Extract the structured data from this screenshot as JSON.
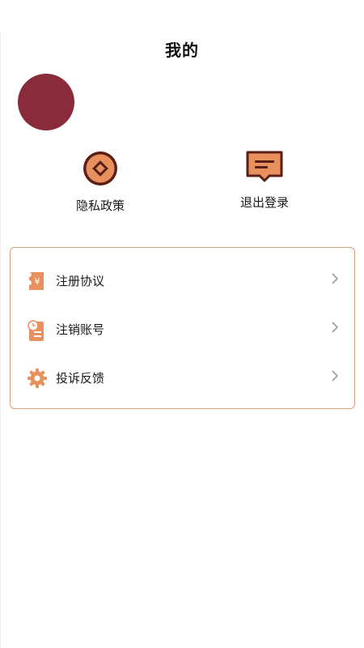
{
  "header": {
    "title": "我的"
  },
  "quick_actions": {
    "privacy_label": "隐私政策",
    "logout_label": "退出登录"
  },
  "menu": {
    "items": [
      {
        "label": "注册协议",
        "icon": "receipt-yen-icon"
      },
      {
        "label": "注销账号",
        "icon": "document-clock-icon"
      },
      {
        "label": "投诉反馈",
        "icon": "gear-icon"
      }
    ]
  },
  "colors": {
    "accent": "#e8915f",
    "dark_brown": "#5a1f17",
    "avatar": "#8a2b3c",
    "card_border": "#d9a27f"
  }
}
